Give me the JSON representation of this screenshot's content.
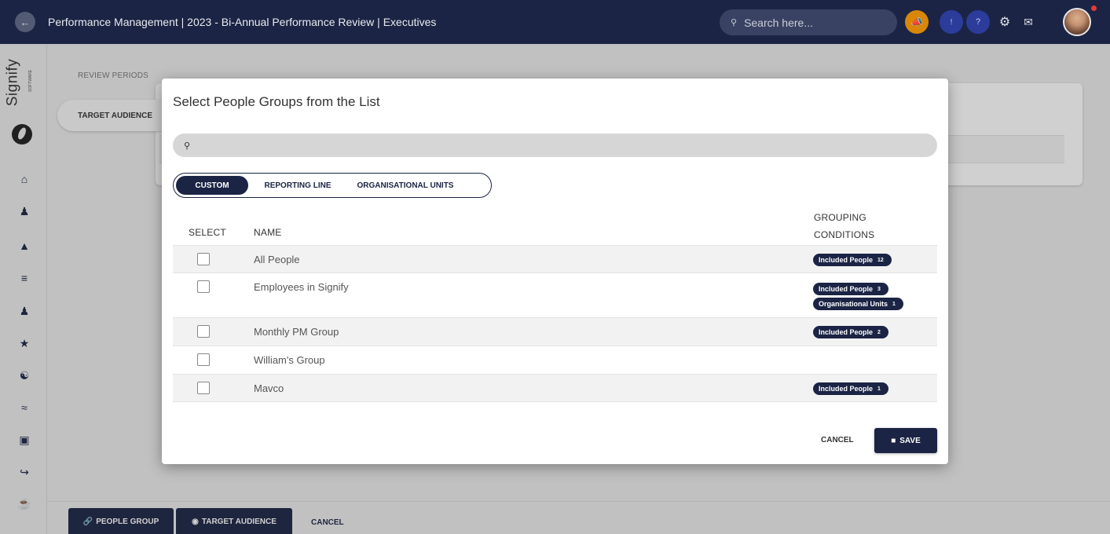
{
  "header": {
    "title": "Performance Management | 2023 - Bi-Annual Performance Review | Executives",
    "search_placeholder": "Search here..."
  },
  "sidebar": {
    "logo_text": "Signify",
    "logo_subtext": "SOFTWARE",
    "icons": [
      "home-icon",
      "user-icon",
      "graduation-cap-icon",
      "sliders-icon",
      "users-icon",
      "star-icon",
      "group-icon",
      "handshake-icon",
      "calendar-icon",
      "hierarchy-icon",
      "trophy-icon"
    ]
  },
  "background": {
    "section_label": "REVIEW PERIODS",
    "tab_label": "TARGET AUDIENCE"
  },
  "footer": {
    "people_group_label": "PEOPLE GROUP",
    "target_audience_label": "TARGET AUDIENCE",
    "cancel_label": "CANCEL"
  },
  "modal": {
    "title": "Select People Groups from the List",
    "search_value": "",
    "tabs": [
      {
        "label": "CUSTOM",
        "active": true
      },
      {
        "label": "REPORTING LINE",
        "active": false
      },
      {
        "label": "ORGANISATIONAL UNITS",
        "active": false
      }
    ],
    "columns": {
      "select": "SELECT",
      "name": "NAME",
      "grouping_line1": "GROUPING",
      "grouping_line2": "CONDITIONS"
    },
    "rows": [
      {
        "name": "All People",
        "checked": false,
        "conditions": [
          {
            "label": "Included People",
            "count": "12"
          }
        ]
      },
      {
        "name": "Employees in Signify",
        "checked": false,
        "conditions": [
          {
            "label": "Included People",
            "count": "3"
          },
          {
            "label": "Organisational Units",
            "count": "1"
          }
        ]
      },
      {
        "name": "Monthly PM Group",
        "checked": false,
        "conditions": [
          {
            "label": "Included People",
            "count": "2"
          }
        ]
      },
      {
        "name": "William's Group",
        "checked": false,
        "conditions": []
      },
      {
        "name": "Mavco",
        "checked": false,
        "conditions": [
          {
            "label": "Included People",
            "count": "1"
          }
        ]
      }
    ],
    "cancel_label": "CANCEL",
    "save_label": "SAVE"
  }
}
